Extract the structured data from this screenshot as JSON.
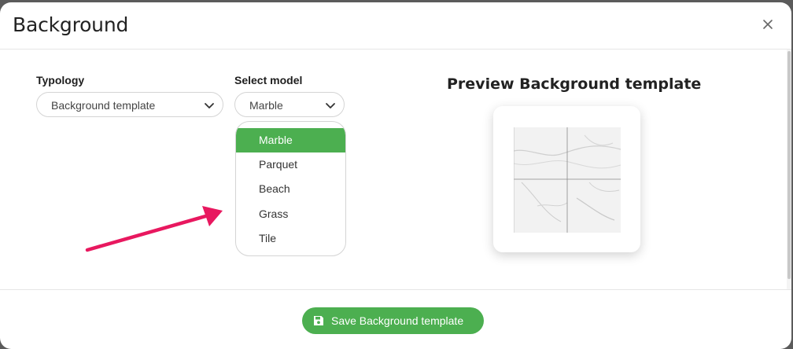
{
  "dialog": {
    "title": "Background"
  },
  "typology": {
    "label": "Typology",
    "selected": "Background template"
  },
  "model": {
    "label": "Select model",
    "selected": "Marble",
    "options": [
      "Marble",
      "Parquet",
      "Beach",
      "Grass",
      "Tile"
    ]
  },
  "preview": {
    "title": "Preview Background template"
  },
  "footer": {
    "save_label": "Save Background template"
  },
  "colors": {
    "accent": "#4caf50",
    "arrow": "#e8185f"
  },
  "icons": {
    "close": "close-icon",
    "chevron": "chevron-down-icon",
    "save": "floppy-disk-icon"
  }
}
